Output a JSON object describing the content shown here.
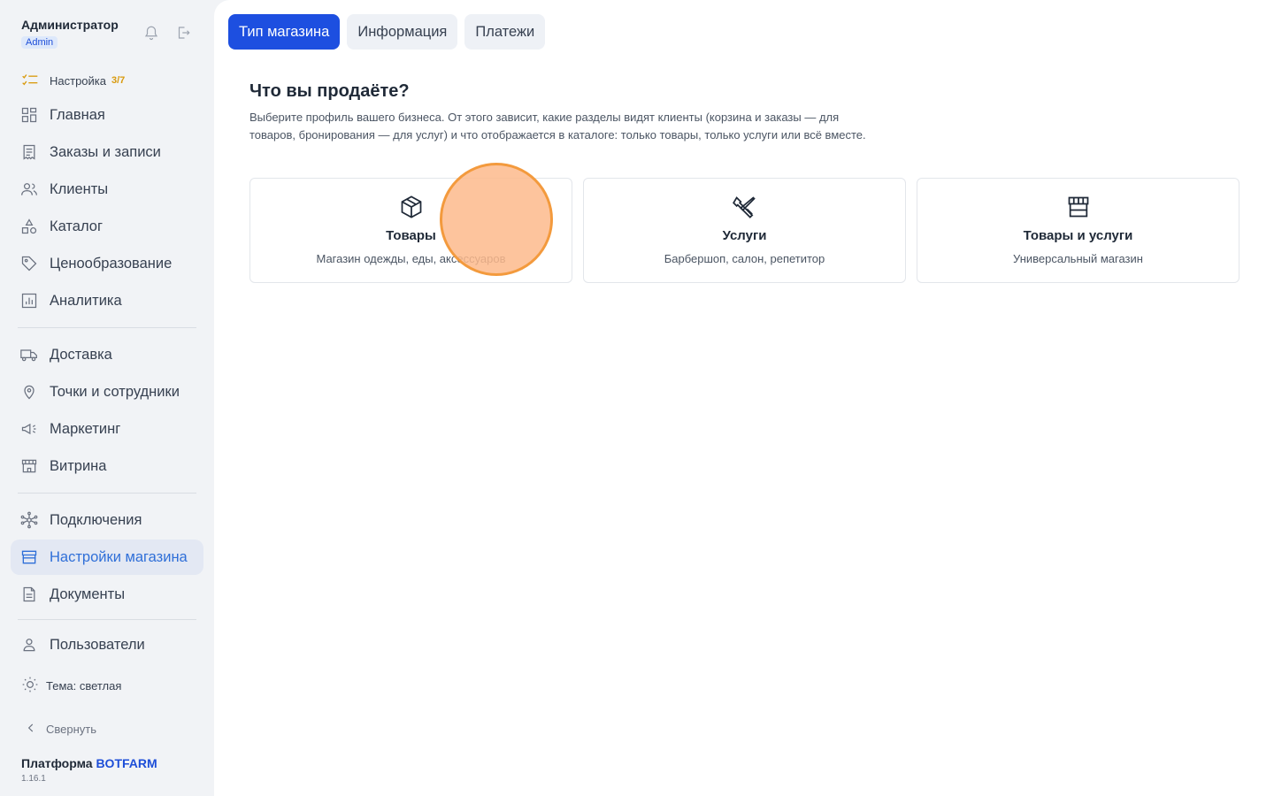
{
  "profile": {
    "name": "Администратор",
    "role": "Admin"
  },
  "setup": {
    "label": "Настройка",
    "count": "3/7"
  },
  "nav": [
    {
      "label": "Главная",
      "icon": "grid-icon"
    },
    {
      "label": "Заказы и записи",
      "icon": "receipt-icon"
    },
    {
      "label": "Клиенты",
      "icon": "users-icon"
    },
    {
      "label": "Каталог",
      "icon": "shapes-icon"
    },
    {
      "label": "Ценообразование",
      "icon": "tag-icon"
    },
    {
      "label": "Аналитика",
      "icon": "chart-icon"
    },
    {
      "label": "Доставка",
      "icon": "truck-icon"
    },
    {
      "label": "Точки и сотрудники",
      "icon": "map-pin-icon"
    },
    {
      "label": "Маркетинг",
      "icon": "megaphone-icon"
    },
    {
      "label": "Витрина",
      "icon": "storefront-icon"
    },
    {
      "label": "Подключения",
      "icon": "network-icon"
    },
    {
      "label": "Настройки магазина",
      "icon": "store-icon"
    },
    {
      "label": "Документы",
      "icon": "document-icon"
    },
    {
      "label": "Пользователи",
      "icon": "user-icon"
    }
  ],
  "theme_label": "Тема: светлая",
  "collapse_label": "Свернуть",
  "platform": {
    "prefix": "Платформа",
    "brand": "BOTFARM",
    "version": "1.16.1"
  },
  "tabs": [
    "Тип магазина",
    "Информация",
    "Платежи"
  ],
  "heading": "Что вы продаёте?",
  "description": "Выберите профиль вашего бизнеса. От этого зависит, какие разделы видят клиенты (корзина и заказы — для товаров, бронирования — для услуг) и что отображается в каталоге: только товары, только услуги или всё вместе.",
  "cards": [
    {
      "title": "Товары",
      "subtitle": "Магазин одежды, еды, аксессуаров",
      "icon": "box-icon"
    },
    {
      "title": "Услуги",
      "subtitle": "Барбершоп, салон, репетитор",
      "icon": "tools-icon"
    },
    {
      "title": "Товары и услуги",
      "subtitle": "Универсальный магазин",
      "icon": "storefront-icon"
    }
  ],
  "colors": {
    "accent": "#1d4fe0",
    "active_nav": "#2f6fd8",
    "setup_count": "#d99a0d",
    "cursor": "#f39a3d"
  }
}
